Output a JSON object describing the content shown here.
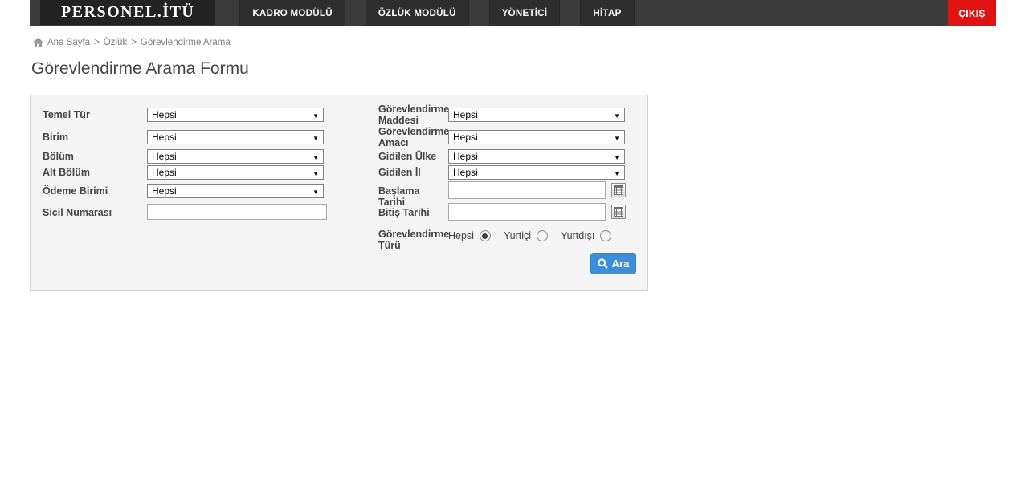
{
  "header": {
    "logo": "PERSONEL.İTÜ",
    "nav": [
      {
        "label": "KADRO MODÜLÜ"
      },
      {
        "label": "ÖZLÜK MODÜLÜ"
      },
      {
        "label": "YÖNETİCİ"
      },
      {
        "label": "HİTAP"
      }
    ],
    "logout": "ÇIKIŞ"
  },
  "breadcrumb": {
    "home_label": "Ana Sayfa",
    "separator": ">",
    "items": [
      "Özlük",
      "Görevlendirme Arama"
    ]
  },
  "page": {
    "title": "Görevlendirme Arama Formu"
  },
  "form": {
    "fields": {
      "temel_tur": {
        "label": "Temel Tür",
        "value": "Hepsi"
      },
      "birim": {
        "label": "Birim",
        "value": "Hepsi"
      },
      "bolum": {
        "label": "Bölüm",
        "value": "Hepsi"
      },
      "alt_bolum": {
        "label": "Alt Bölüm",
        "value": "Hepsi"
      },
      "odeme_birimi": {
        "label": "Ödeme Birimi",
        "value": "Hepsi"
      },
      "sicil_numarasi": {
        "label": "Sicil Numarası",
        "value": ""
      },
      "gorevlendirme_maddesi": {
        "label": "Görevlendirme Maddesi",
        "value": "Hepsi"
      },
      "gorevlendirme_amaci": {
        "label": "Görevlendirme Amacı",
        "value": "Hepsi"
      },
      "gidilen_ulke": {
        "label": "Gidilen Ülke",
        "value": "Hepsi"
      },
      "gidilen_il": {
        "label": "Gidilen İl",
        "value": "Hepsi"
      },
      "baslama_tarihi": {
        "label": "Başlama Tarihi",
        "value": ""
      },
      "bitis_tarihi": {
        "label": "Bitiş Tarihi",
        "value": ""
      },
      "gorevlendirme_turu": {
        "label": "Görevlendirme Türü",
        "options": [
          "Hepsi",
          "Yurtiçi",
          "Yurtdışı"
        ],
        "selected": "Hepsi"
      }
    },
    "search_button": "Ara"
  },
  "colors": {
    "header_bg": "#3a3a3a",
    "logo_bg": "#232323",
    "nav_item_bg": "#2e2e2e",
    "logout_red": "#e11212",
    "accent_blue": "#3c8ed9",
    "panel_bg": "#f4f4f4"
  }
}
